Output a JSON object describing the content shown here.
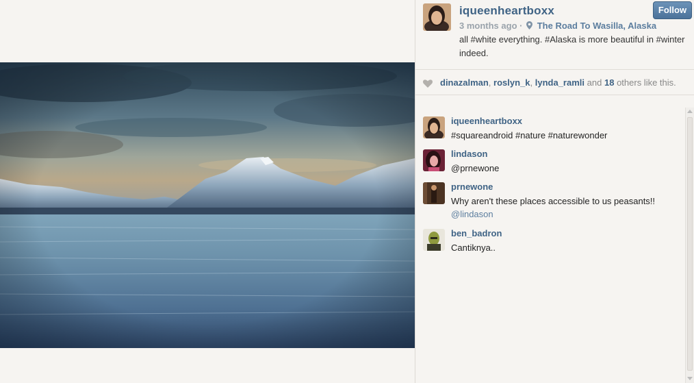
{
  "post": {
    "username": "iqueenheartboxx",
    "follow_label": "Follow",
    "time_ago": "3 months ago",
    "separator": "·",
    "location": "The Road To Wasilla, Alaska",
    "caption": "all #white everything. #Alaska is more beautiful in #winter indeed."
  },
  "likes": {
    "users": [
      "dinazalman",
      "roslyn_k",
      "lynda_ramli"
    ],
    "and_text": "and",
    "others_count": "18",
    "others_text": "others like this."
  },
  "comments": [
    {
      "username": "iqueenheartboxx",
      "text": "#squareandroid #nature #naturewonder"
    },
    {
      "username": "lindason",
      "text": "@prnewone"
    },
    {
      "username": "prnewone",
      "text": "Why aren't these places accessible to us peasants!!",
      "text2": "@lindason"
    },
    {
      "username": "ben_badron",
      "text": "Cantiknya.."
    }
  ],
  "icons": {
    "location": "pin-icon",
    "likes": "heart-icon"
  },
  "colors": {
    "link": "#3f6385",
    "muted": "#9aa3ab",
    "follow_button": "#5680a8"
  }
}
